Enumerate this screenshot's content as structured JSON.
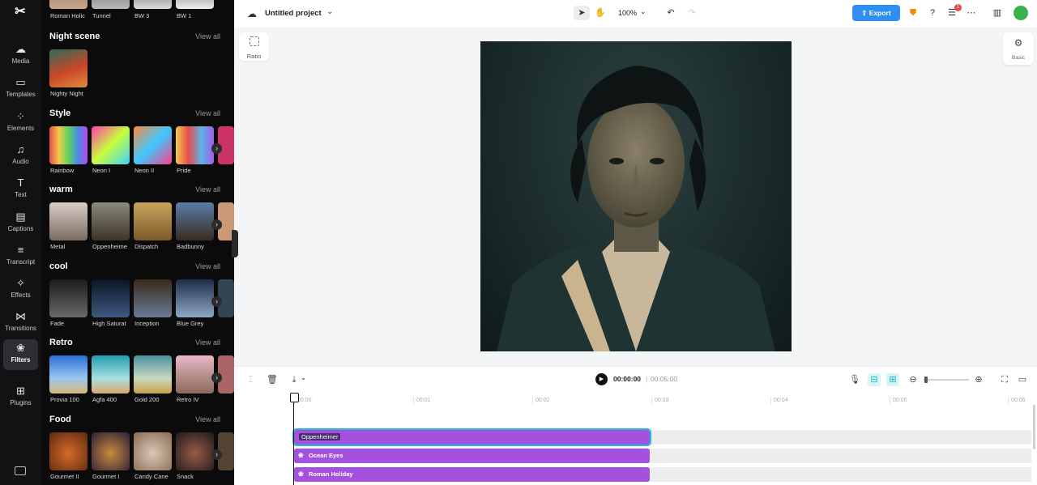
{
  "app": {
    "name": "CapCut"
  },
  "rail": {
    "items": [
      {
        "label": "Media",
        "icon": "cloud-upload-icon"
      },
      {
        "label": "Templates",
        "icon": "templates-icon"
      },
      {
        "label": "Elements",
        "icon": "elements-icon"
      },
      {
        "label": "Audio",
        "icon": "music-note-icon"
      },
      {
        "label": "Text",
        "icon": "text-icon"
      },
      {
        "label": "Captions",
        "icon": "captions-icon"
      },
      {
        "label": "Transcript",
        "icon": "transcript-icon"
      },
      {
        "label": "Effects",
        "icon": "sparkle-icon"
      },
      {
        "label": "Transitions",
        "icon": "transitions-icon"
      },
      {
        "label": "Filters",
        "icon": "filters-icon"
      },
      {
        "label": "Plugins",
        "icon": "plugins-icon"
      }
    ],
    "active": "Filters"
  },
  "panel": {
    "top_strip": [
      "Roman Holic",
      "Tunnel",
      "BW 3",
      "BW 1"
    ],
    "view_all": "View all",
    "sections": [
      {
        "title": "Night scene",
        "items": [
          "Nighty Night"
        ]
      },
      {
        "title": "Style",
        "items": [
          "Rainbow",
          "Neon I",
          "Neon II",
          "Pride"
        ]
      },
      {
        "title": "warm",
        "items": [
          "Metal",
          "Oppenheime",
          "Dispatch",
          "Badbunny"
        ]
      },
      {
        "title": "cool",
        "items": [
          "Fade",
          "High Saturat",
          "Inception",
          "Blue Grey"
        ]
      },
      {
        "title": "Retro",
        "items": [
          "Provia 100",
          "Agfa 400",
          "Gold 200",
          "Retro IV"
        ]
      },
      {
        "title": "Food",
        "items": [
          "Gourmet II",
          "Gourmet I",
          "Candy Cane",
          "Snack"
        ]
      }
    ]
  },
  "topbar": {
    "project_name": "Untitled project",
    "zoom": "100%",
    "export_label": "Export",
    "notification_count": "1"
  },
  "canvas_tools": {
    "ratio_label": "Ratio",
    "basic_label": "Basic"
  },
  "player": {
    "current_time": "00:00:00",
    "separator": "|",
    "duration": "00:05:00"
  },
  "timeline": {
    "ticks": [
      "00:00",
      "00:01",
      "00:02",
      "00:03",
      "00:04",
      "00:05",
      "00:06"
    ],
    "tracks": [
      {
        "label": "Oppenheimer",
        "selected": true
      },
      {
        "label": "Ocean Eyes",
        "selected": false
      },
      {
        "label": "Roman Holiday",
        "selected": false
      }
    ]
  },
  "colors": {
    "accent": "#2f8ff0",
    "clip": "#a451e0",
    "selection": "#22b8cf"
  }
}
